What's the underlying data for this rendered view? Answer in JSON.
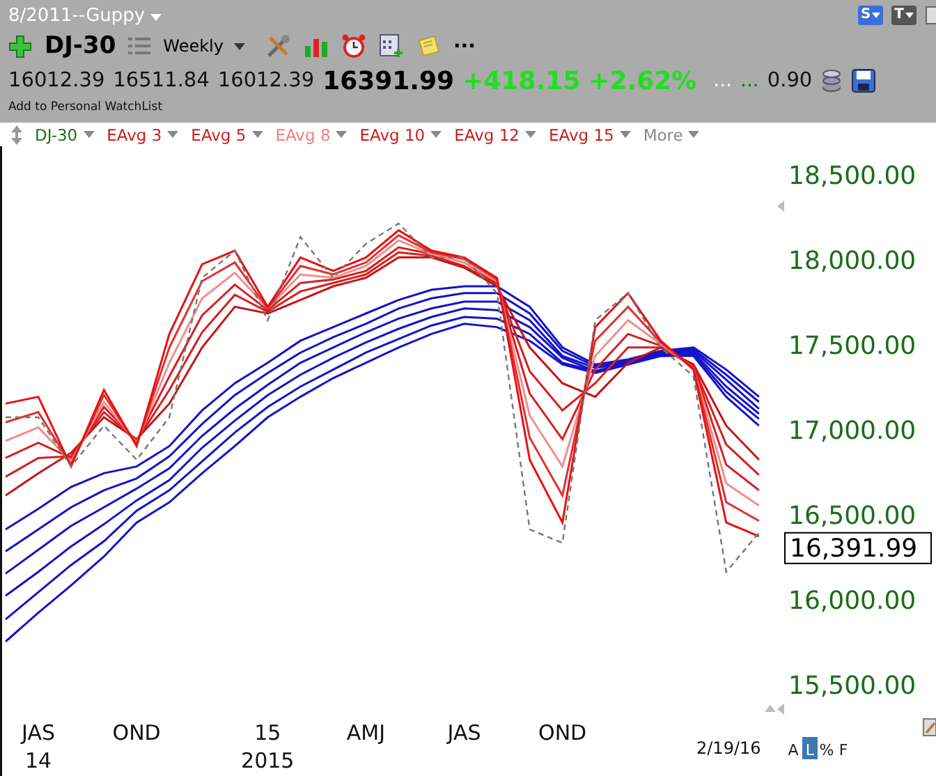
{
  "header": {
    "title": "8/2011--Guppy",
    "symbol": "DJ-30",
    "period": "Weekly",
    "more": "...",
    "corner_buttons": [
      {
        "label": "S",
        "color": "#3a6fd8"
      },
      {
        "label": "T",
        "color": "#555555"
      }
    ],
    "quote": {
      "open": "16012.39",
      "high": "16511.84",
      "low": "16012.39",
      "last": "16391.99",
      "change": "+418.15",
      "change_pct": "+2.62%",
      "ellipsis_1": "...",
      "ellipsis_2": "...",
      "ratio": "0.90"
    },
    "watchlist_link": "Add to Personal WatchList"
  },
  "legend": [
    {
      "label": "DJ-30",
      "color": "#1a6e1a"
    },
    {
      "label": "EAvg 3",
      "color": "#c81e1e"
    },
    {
      "label": "EAvg 5",
      "color": "#c81e1e"
    },
    {
      "label": "EAvg 8",
      "color": "#ee8080"
    },
    {
      "label": "EAvg 10",
      "color": "#c81e1e"
    },
    {
      "label": "EAvg 12",
      "color": "#c81e1e"
    },
    {
      "label": "EAvg 15",
      "color": "#c81e1e"
    },
    {
      "label": "More",
      "color": "#888888"
    }
  ],
  "chart": {
    "price_tag": "16,391.99",
    "last_date": "2/19/16",
    "year_labels": [
      "14",
      "2015"
    ],
    "scale_buttons": [
      {
        "label": "A",
        "selected": false
      },
      {
        "label": "L",
        "selected": true
      },
      {
        "label": "%",
        "selected": false
      },
      {
        "label": "F",
        "selected": false
      }
    ],
    "chart_data": {
      "type": "line",
      "categories": [
        null,
        "JAS",
        null,
        null,
        "OND",
        null,
        null,
        null,
        "15",
        null,
        null,
        "AMJ",
        null,
        null,
        "JAS",
        null,
        null,
        "OND",
        null,
        null,
        null,
        null,
        null,
        null
      ],
      "ylim": [
        15500,
        18500
      ],
      "yticks": [
        {
          "value": 15500,
          "label": "15,500.00"
        },
        {
          "value": 16000,
          "label": "16,000.00"
        },
        {
          "value": 16500,
          "label": "16,500.00"
        },
        {
          "value": 17000,
          "label": "17,000.00"
        },
        {
          "value": 17500,
          "label": "17,500.00"
        },
        {
          "value": 18000,
          "label": "18,000.00"
        },
        {
          "value": 18500,
          "label": "18,500.00"
        }
      ],
      "series": [
        {
          "color": "#1414c8",
          "values": [
            16410,
            16530,
            16660,
            16740,
            16780,
            16900,
            17110,
            17270,
            17390,
            17520,
            17600,
            17680,
            17760,
            17820,
            17840,
            17840,
            17720,
            17480,
            17380,
            17410,
            17460,
            17480,
            17350,
            17190
          ]
        },
        {
          "color": "#1414c8",
          "values": [
            16280,
            16410,
            16540,
            16640,
            16710,
            16840,
            17030,
            17200,
            17330,
            17450,
            17540,
            17620,
            17710,
            17770,
            17800,
            17800,
            17680,
            17460,
            17370,
            17400,
            17450,
            17470,
            17320,
            17160
          ]
        },
        {
          "color": "#1414c8",
          "values": [
            16150,
            16290,
            16430,
            16540,
            16650,
            16770,
            16960,
            17120,
            17260,
            17390,
            17480,
            17570,
            17650,
            17710,
            17750,
            17750,
            17640,
            17430,
            17360,
            17390,
            17450,
            17460,
            17290,
            17120
          ]
        },
        {
          "color": "#1414c8",
          "values": [
            16020,
            16160,
            16310,
            16440,
            16580,
            16700,
            16890,
            17050,
            17200,
            17320,
            17420,
            17510,
            17590,
            17660,
            17710,
            17700,
            17600,
            17420,
            17340,
            17390,
            17440,
            17450,
            17250,
            17090
          ]
        },
        {
          "color": "#1414c8",
          "values": [
            15880,
            16040,
            16200,
            16340,
            16520,
            16640,
            16810,
            16980,
            17130,
            17250,
            17350,
            17450,
            17530,
            17610,
            17660,
            17650,
            17560,
            17390,
            17340,
            17390,
            17430,
            17440,
            17220,
            17060
          ]
        },
        {
          "color": "#1414c8",
          "values": [
            15750,
            15920,
            16080,
            16250,
            16450,
            16570,
            16740,
            16900,
            17070,
            17190,
            17300,
            17390,
            17480,
            17560,
            17620,
            17600,
            17520,
            17380,
            17330,
            17380,
            17430,
            17430,
            17190,
            17020
          ]
        },
        {
          "color": "#c81414",
          "values": [
            16610,
            16740,
            16860,
            17070,
            16940,
            17150,
            17480,
            17720,
            17680,
            17760,
            17840,
            17890,
            18010,
            18010,
            17950,
            17840,
            17480,
            17270,
            17190,
            17390,
            17480,
            17380,
            17020,
            16820
          ]
        },
        {
          "color": "#d42020",
          "values": [
            16720,
            16830,
            16840,
            17100,
            16930,
            17230,
            17570,
            17790,
            17690,
            17810,
            17860,
            17910,
            18040,
            18020,
            17960,
            17850,
            17340,
            17110,
            17270,
            17480,
            17480,
            17370,
            16910,
            16730
          ]
        },
        {
          "color": "#d42020",
          "values": [
            16830,
            16920,
            16830,
            17130,
            16930,
            17310,
            17670,
            17850,
            17700,
            17860,
            17880,
            17930,
            18070,
            18030,
            17980,
            17860,
            17210,
            16940,
            17350,
            17560,
            17490,
            17370,
            16790,
            16640
          ]
        },
        {
          "color": "#f09090",
          "values": [
            16930,
            17010,
            16810,
            17160,
            16920,
            17390,
            17770,
            17920,
            17710,
            17910,
            17890,
            17960,
            18110,
            18030,
            17980,
            17870,
            17080,
            16780,
            17430,
            17640,
            17500,
            17360,
            16680,
            16550
          ]
        },
        {
          "color": "#e03030",
          "values": [
            17040,
            17100,
            16790,
            17200,
            16910,
            17480,
            17870,
            17980,
            17710,
            17960,
            17910,
            17980,
            18140,
            18040,
            18000,
            17880,
            16950,
            16610,
            17520,
            17720,
            17510,
            17360,
            16570,
            16460
          ]
        },
        {
          "color": "#e81010",
          "values": [
            17150,
            17190,
            16780,
            17230,
            16900,
            17560,
            17970,
            18050,
            17720,
            18010,
            17930,
            18010,
            18170,
            18050,
            18010,
            17890,
            16820,
            16450,
            17600,
            17800,
            17520,
            17350,
            16450,
            16370
          ]
        },
        {
          "color": "#777777",
          "line_style": "dashed",
          "values": [
            17070,
            17070,
            16780,
            17020,
            16820,
            17070,
            17890,
            18050,
            17640,
            18130,
            17890,
            18090,
            18210,
            18010,
            18010,
            17800,
            16410,
            16330,
            17640,
            17800,
            17480,
            17310,
            16160,
            16390
          ]
        }
      ]
    }
  }
}
